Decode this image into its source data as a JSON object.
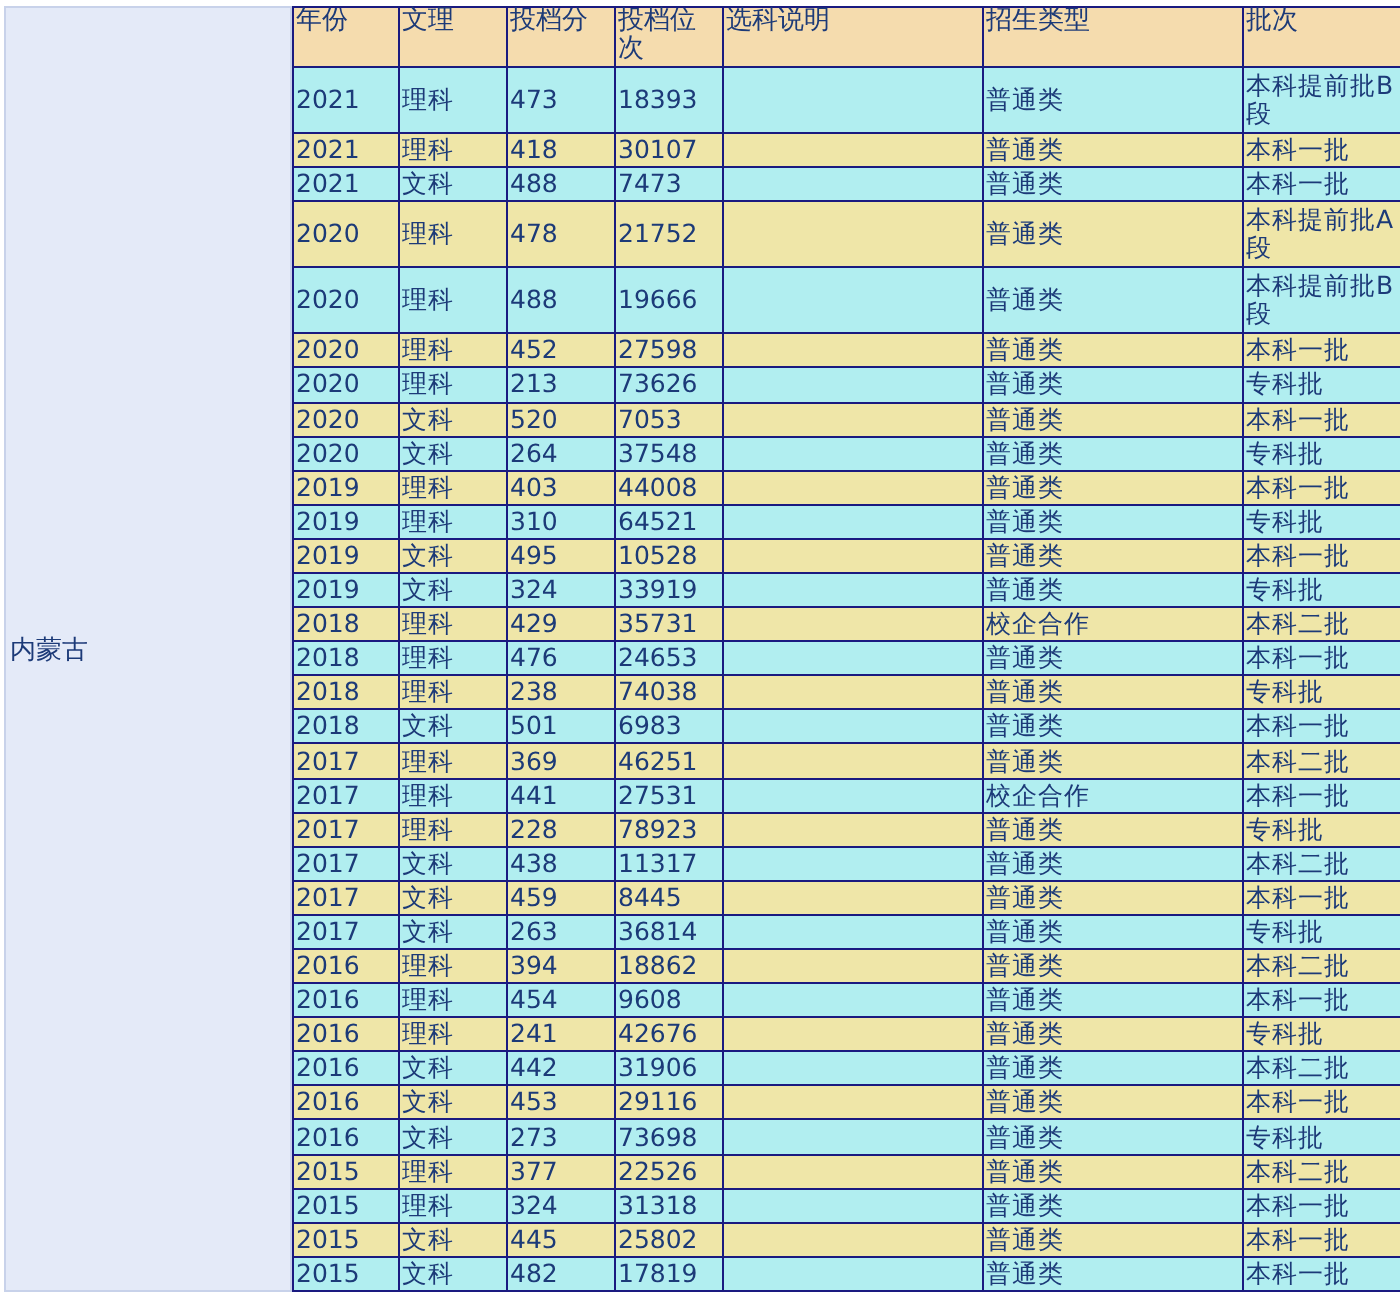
{
  "province": "内蒙古",
  "table": {
    "columns": [
      "年份",
      "文理",
      "投档分",
      "投档位次",
      "选科说明",
      "招生类型",
      "批次"
    ],
    "rows": [
      {
        "year": "2021",
        "track": "理科",
        "score": "473",
        "rank": "18393",
        "type": "普通类",
        "batch": "本科提前批B段"
      },
      {
        "year": "2021",
        "track": "理科",
        "score": "418",
        "rank": "30107",
        "type": "普通类",
        "batch": "本科一批"
      },
      {
        "year": "2021",
        "track": "文科",
        "score": "488",
        "rank": "7473",
        "type": "普通类",
        "batch": "本科一批"
      },
      {
        "year": "2020",
        "track": "理科",
        "score": "478",
        "rank": "21752",
        "type": "普通类",
        "batch": "本科提前批A段"
      },
      {
        "year": "2020",
        "track": "理科",
        "score": "488",
        "rank": "19666",
        "type": "普通类",
        "batch": "本科提前批B段"
      },
      {
        "year": "2020",
        "track": "理科",
        "score": "452",
        "rank": "27598",
        "type": "普通类",
        "batch": "本科一批"
      },
      {
        "year": "2020",
        "track": "理科",
        "score": "213",
        "rank": "73626",
        "type": "普通类",
        "batch": "专科批"
      },
      {
        "year": "2020",
        "track": "文科",
        "score": "520",
        "rank": "7053",
        "type": "普通类",
        "batch": "本科一批"
      },
      {
        "year": "2020",
        "track": "文科",
        "score": "264",
        "rank": "37548",
        "type": "普通类",
        "batch": "专科批"
      },
      {
        "year": "2019",
        "track": "理科",
        "score": "403",
        "rank": "44008",
        "type": "普通类",
        "batch": "本科一批"
      },
      {
        "year": "2019",
        "track": "理科",
        "score": "310",
        "rank": "64521",
        "type": "普通类",
        "batch": "专科批"
      },
      {
        "year": "2019",
        "track": "文科",
        "score": "495",
        "rank": "10528",
        "type": "普通类",
        "batch": "本科一批"
      },
      {
        "year": "2019",
        "track": "文科",
        "score": "324",
        "rank": "33919",
        "type": "普通类",
        "batch": "专科批"
      },
      {
        "year": "2018",
        "track": "理科",
        "score": "429",
        "rank": "35731",
        "type": "校企合作",
        "batch": "本科二批"
      },
      {
        "year": "2018",
        "track": "理科",
        "score": "476",
        "rank": "24653",
        "type": "普通类",
        "batch": "本科一批"
      },
      {
        "year": "2018",
        "track": "理科",
        "score": "238",
        "rank": "74038",
        "type": "普通类",
        "batch": "专科批"
      },
      {
        "year": "2018",
        "track": "文科",
        "score": "501",
        "rank": "6983",
        "type": "普通类",
        "batch": "本科一批"
      },
      {
        "year": "2017",
        "track": "理科",
        "score": "369",
        "rank": "46251",
        "type": "普通类",
        "batch": "本科二批"
      },
      {
        "year": "2017",
        "track": "理科",
        "score": "441",
        "rank": "27531",
        "type": "校企合作",
        "batch": "本科一批"
      },
      {
        "year": "2017",
        "track": "理科",
        "score": "228",
        "rank": "78923",
        "type": "普通类",
        "batch": "专科批"
      },
      {
        "year": "2017",
        "track": "文科",
        "score": "438",
        "rank": "11317",
        "type": "普通类",
        "batch": "本科二批"
      },
      {
        "year": "2017",
        "track": "文科",
        "score": "459",
        "rank": "8445",
        "type": "普通类",
        "batch": "本科一批"
      },
      {
        "year": "2017",
        "track": "文科",
        "score": "263",
        "rank": "36814",
        "type": "普通类",
        "batch": "专科批"
      },
      {
        "year": "2016",
        "track": "理科",
        "score": "394",
        "rank": "18862",
        "type": "普通类",
        "batch": "本科二批"
      },
      {
        "year": "2016",
        "track": "理科",
        "score": "454",
        "rank": "9608",
        "type": "普通类",
        "batch": "本科一批"
      },
      {
        "year": "2016",
        "track": "理科",
        "score": "241",
        "rank": "42676",
        "type": "普通类",
        "batch": "专科批"
      },
      {
        "year": "2016",
        "track": "文科",
        "score": "442",
        "rank": "31906",
        "type": "普通类",
        "batch": "本科二批"
      },
      {
        "year": "2016",
        "track": "文科",
        "score": "453",
        "rank": "29116",
        "type": "普通类",
        "batch": "本科一批"
      },
      {
        "year": "2016",
        "track": "文科",
        "score": "273",
        "rank": "73698",
        "type": "普通类",
        "batch": "专科批"
      },
      {
        "year": "2015",
        "track": "理科",
        "score": "377",
        "rank": "22526",
        "type": "普通类",
        "batch": "本科二批"
      },
      {
        "year": "2015",
        "track": "理科",
        "score": "324",
        "rank": "31318",
        "type": "普通类",
        "batch": "本科一批"
      },
      {
        "year": "2015",
        "track": "文科",
        "score": "445",
        "rank": "25802",
        "type": "普通类",
        "batch": "本科一批"
      },
      {
        "year": "2015",
        "track": "文科",
        "score": "482",
        "rank": "17819",
        "type": "普通类",
        "batch": "本科一批"
      }
    ]
  }
}
